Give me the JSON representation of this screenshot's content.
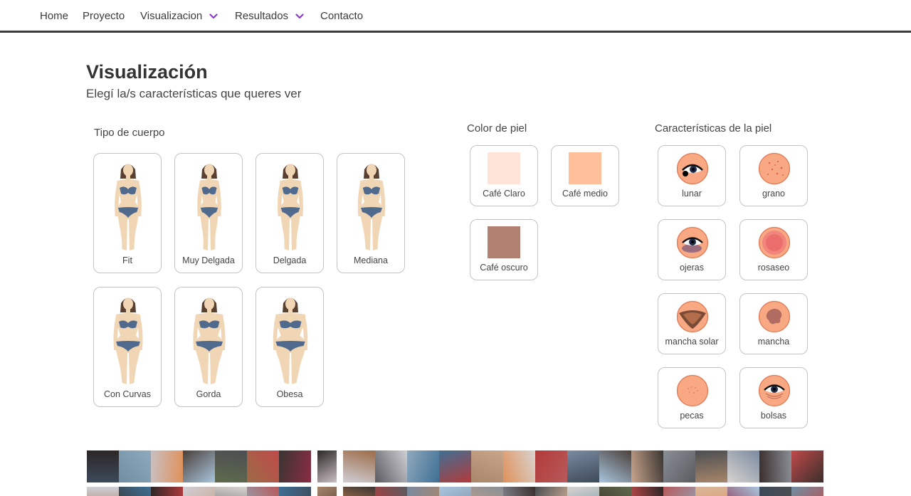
{
  "nav": {
    "items": [
      "Home",
      "Proyecto",
      "Visualizacion",
      "Resultados",
      "Contacto"
    ],
    "accent": "#8a3cc8"
  },
  "header": {
    "title": "Visualización",
    "subtitle": "Elegí la/s características que queres ver"
  },
  "body_types": {
    "label": "Tipo de cuerpo",
    "items": [
      "Fit",
      "Muy Delgada",
      "Delgada",
      "Mediana",
      "Con Curvas",
      "Gorda",
      "Obesa"
    ]
  },
  "skin_color": {
    "label": "Color de piel",
    "items": [
      {
        "label": "Café Claro",
        "color": "#fde3d8"
      },
      {
        "label": "Café medio",
        "color": "#ffbf9b"
      },
      {
        "label": "Café oscuro",
        "color": "#b08070"
      }
    ]
  },
  "skin_features": {
    "label": "Características de la piel",
    "items": [
      {
        "label": "lunar",
        "icon": "eye-mole-icon"
      },
      {
        "label": "grano",
        "icon": "pimples-icon"
      },
      {
        "label": "ojeras",
        "icon": "dark-circles-icon"
      },
      {
        "label": "rosaseo",
        "icon": "rosacea-icon"
      },
      {
        "label": "mancha solar",
        "icon": "sun-spot-icon"
      },
      {
        "label": "mancha",
        "icon": "spot-icon"
      },
      {
        "label": "pecas",
        "icon": "freckles-icon"
      },
      {
        "label": "bolsas",
        "icon": "eye-bags-icon"
      }
    ]
  },
  "photo_strip": {
    "tile_colors": [
      "#3d4a5a",
      "#6f8fa3",
      "#c9c0c4",
      "#4a3f3a",
      "#5f6a4c",
      "#9c6b47",
      "#3a3532",
      "#2c2626",
      "#d0cfd6",
      "#5a5b60",
      "#8fa9bd",
      "#3f6f94",
      "#a8866a",
      "#e0915a",
      "#b23a3a",
      "#7a8aa0",
      "#a9c6de",
      "#c9a58c",
      "#8a8f96",
      "#4b4e52",
      "#d8d4d0",
      "#3a2e2c",
      "#c04a4a",
      "#b85a5a",
      "#d9b79c",
      "#8a2c44"
    ]
  }
}
